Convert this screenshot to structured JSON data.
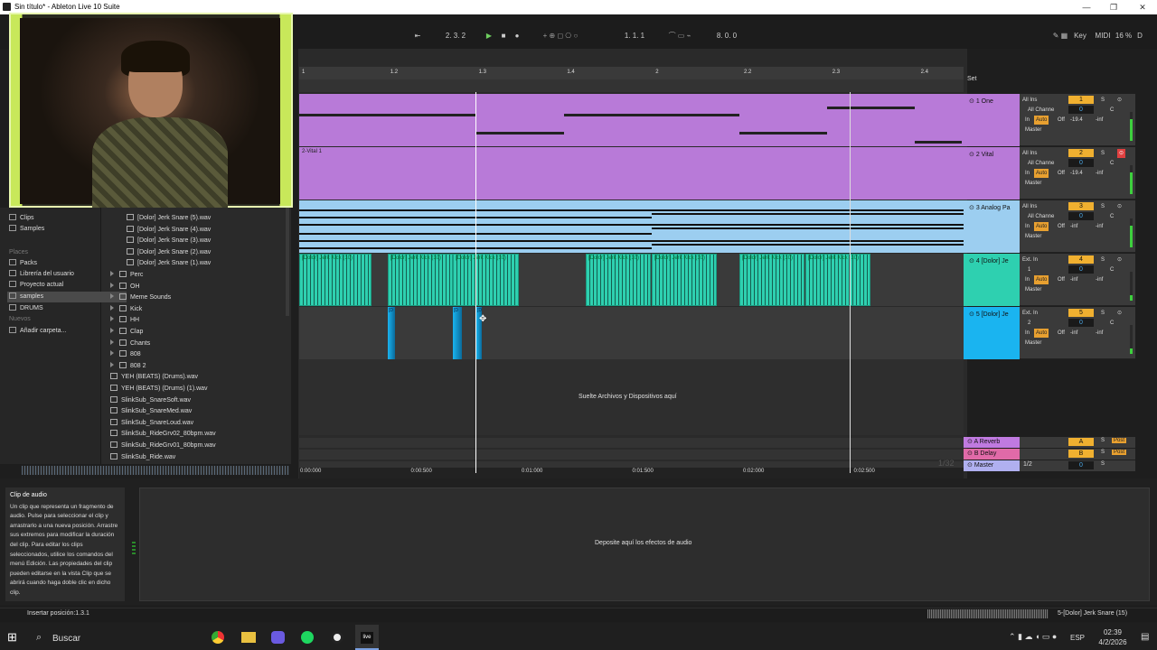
{
  "window": {
    "title": "Sin título* - Ableton Live 10 Suite",
    "min": "—",
    "max": "❐",
    "close": "✕"
  },
  "controlbar": {
    "arrangement_pos": "2.  3.  2",
    "loop_start": "1.  1.  1",
    "loop_length": "8.  0.  0",
    "key": "Key",
    "midi": "MIDI",
    "cpu": "16 %",
    "d": "D"
  },
  "browser": {
    "places": [
      {
        "label": "Clips",
        "type": "item"
      },
      {
        "label": "Samples",
        "type": "item"
      },
      {
        "label": "Places",
        "type": "header"
      },
      {
        "label": "Packs",
        "type": "item"
      },
      {
        "label": "Librería del usuario",
        "type": "item"
      },
      {
        "label": "Proyecto actual",
        "type": "item"
      },
      {
        "label": "samples",
        "type": "selected"
      },
      {
        "label": "DRUMS",
        "type": "item"
      },
      {
        "label": "Nuevos",
        "type": "header"
      },
      {
        "label": "Añadir carpeta...",
        "type": "item"
      }
    ],
    "files": [
      {
        "label": "[Dolor] Jerk Snare (5).wav",
        "kind": "file",
        "indent": 1
      },
      {
        "label": "[Dolor] Jerk Snare (4).wav",
        "kind": "file",
        "indent": 1
      },
      {
        "label": "[Dolor] Jerk Snare (3).wav",
        "kind": "file",
        "indent": 1
      },
      {
        "label": "[Dolor] Jerk Snare (2).wav",
        "kind": "file",
        "indent": 1
      },
      {
        "label": "[Dolor] Jerk Snare (1).wav",
        "kind": "file",
        "indent": 1
      },
      {
        "label": "Perc",
        "kind": "folder",
        "indent": 1
      },
      {
        "label": "OH",
        "kind": "folder",
        "indent": 1
      },
      {
        "label": "Meme Sounds",
        "kind": "folder",
        "indent": 1
      },
      {
        "label": "Kick",
        "kind": "folder",
        "indent": 1
      },
      {
        "label": "HH",
        "kind": "folder",
        "indent": 1
      },
      {
        "label": "Clap",
        "kind": "folder",
        "indent": 1
      },
      {
        "label": "Chants",
        "kind": "folder",
        "indent": 1
      },
      {
        "label": "808",
        "kind": "folder",
        "indent": 1
      },
      {
        "label": "808 2",
        "kind": "folder",
        "indent": 0
      },
      {
        "label": "YEH (BEATS) (Drums).wav",
        "kind": "file",
        "indent": 0
      },
      {
        "label": "YEH (BEATS) (Drums) (1).wav",
        "kind": "file",
        "indent": 0
      },
      {
        "label": "SlinkSub_SnareSoft.wav",
        "kind": "file",
        "indent": 0
      },
      {
        "label": "SlinkSub_SnareMed.wav",
        "kind": "file",
        "indent": 0
      },
      {
        "label": "SlinkSub_SnareLoud.wav",
        "kind": "file",
        "indent": 0
      },
      {
        "label": "SlinkSub_RideGrv02_80bpm.wav",
        "kind": "file",
        "indent": 0
      },
      {
        "label": "SlinkSub_RideGrv01_80bpm.wav",
        "kind": "file",
        "indent": 0
      },
      {
        "label": "SlinkSub_Ride.wav",
        "kind": "file",
        "indent": 0
      }
    ]
  },
  "ruler": [
    "1",
    "1.2",
    "1.3",
    "1.4",
    "2",
    "2.2",
    "2.3",
    "2.4"
  ],
  "set_label": "Set",
  "tracks": [
    {
      "name": "1 One",
      "num": "1",
      "in": "All Ins",
      "chan": "All Channe",
      "vol": "0",
      "pan": "C",
      "sends": "-19.4",
      "inf": "-inf",
      "out": "Master",
      "color": "#b87ad8",
      "monitor": "Auto"
    },
    {
      "name": "2 Vital",
      "num": "2",
      "in": "All Ins",
      "chan": "All Channe",
      "vol": "0",
      "pan": "C",
      "sends": "-19.4",
      "inf": "-inf",
      "out": "Master",
      "color": "#b87ad8",
      "monitor": "Auto",
      "clip": "2-Vital 1"
    },
    {
      "name": "3 Analog Pa",
      "num": "3",
      "in": "All Ins",
      "chan": "All Channe",
      "vol": "0",
      "pan": "C",
      "sends": "-inf",
      "inf": "-inf",
      "out": "Master",
      "color": "#9ccef0",
      "monitor": "Auto"
    },
    {
      "name": "4 [Dolor] Je",
      "num": "4",
      "in": "Ext. In",
      "chan": "1",
      "vol": "0",
      "pan": "C",
      "sends": "-inf",
      "inf": "-inf",
      "out": "Master",
      "color": "#2ed0b0",
      "monitor": "Auto"
    },
    {
      "name": "5 [Dolor] Je",
      "num": "5",
      "in": "Ext. In",
      "chan": "2",
      "vol": "0",
      "pan": "C",
      "sends": "-inf",
      "inf": "-inf",
      "out": "Master",
      "color": "#1ab4f0",
      "monitor": "Auto"
    }
  ],
  "kick_clip": "[Dolor] Jerk Kick (10)",
  "snare_clip": "[D",
  "drop_text": "Suelte Archivos y Dispositivos aquí",
  "returns": [
    {
      "name": "A Reverb",
      "letter": "A",
      "post": "Post",
      "color": "#c07ae0"
    },
    {
      "name": "B Delay",
      "letter": "B",
      "post": "Post",
      "color": "#e06aa8"
    },
    {
      "name": "Master",
      "letter": "0",
      "post": "",
      "color": "#b0b0f0",
      "ratio": "1/2"
    }
  ],
  "zoom_label": "1/32",
  "timeline": [
    "0:00:000",
    "0:00:500",
    "0:01:000",
    "0:01:500",
    "0:02:000",
    "0:02:500"
  ],
  "info": {
    "title": "Clip de audio",
    "body": "Un clip que representa un fragmento de audio. Pulse para seleccionar el clip y arrastrarlo a una nueva posición. Arrastre sus extremos para modificar la duración del clip. Para editar los clips seleccionados, utilice los comandos del menú Edición. Las propiedades del clip pueden editarse en la vista Clip que se abrirá cuando haga doble clic en dicho clip."
  },
  "device_drop": "Deposite aquí los efectos de audio",
  "status": {
    "left": "Insertar posición:1.3.1",
    "right": "5-[Dolor] Jerk Snare (15)"
  },
  "taskbar": {
    "search": "Buscar",
    "lang": "ESP",
    "time": "02:39",
    "date": "4/2/2026"
  }
}
